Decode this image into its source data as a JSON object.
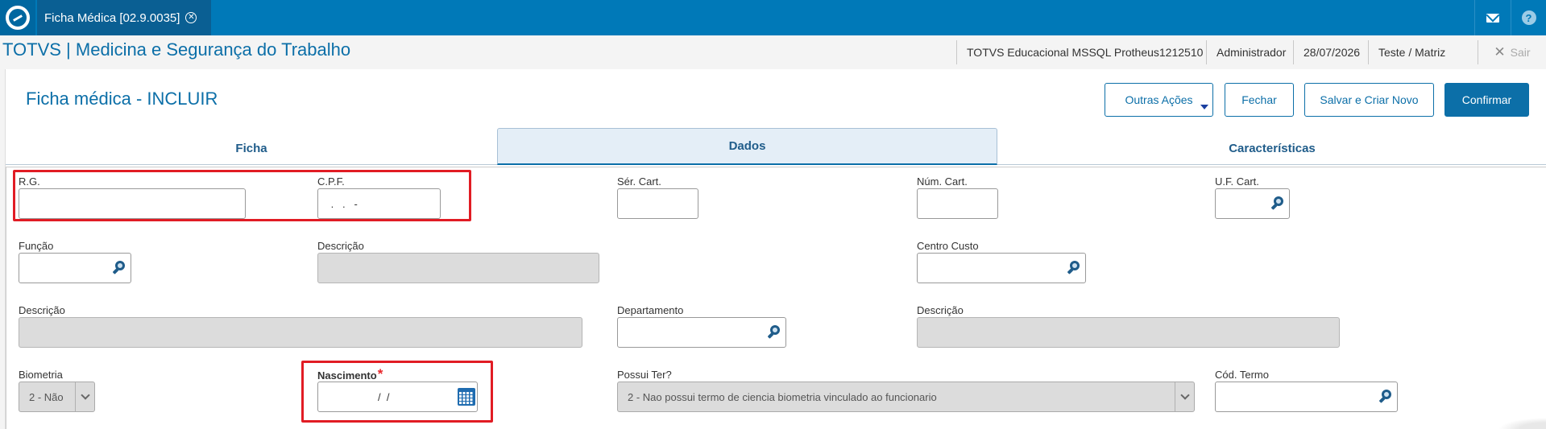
{
  "app": {
    "tab_title": "Ficha Médica [02.9.0035]",
    "tab_close": "✕",
    "brand": "TOTVS | Medicina e Segurança do Trabalho"
  },
  "header": {
    "environment": "TOTVS Educacional MSSQL Protheus1212510",
    "user": "Administrador",
    "date": "28/07/2026",
    "branch": "Teste / Matriz",
    "exit_label": "Sair"
  },
  "page": {
    "title": "Ficha médica - INCLUIR"
  },
  "actions": {
    "other_label": "Outras Ações",
    "close_label": "Fechar",
    "save_new_label": "Salvar e Criar Novo",
    "confirm_label": "Confirmar"
  },
  "tabs": [
    {
      "label": "Ficha"
    },
    {
      "label": "Dados"
    },
    {
      "label": "Características"
    }
  ],
  "form": {
    "rg_label": "R.G.",
    "rg_value": "",
    "cpf_label": "C.P.F.",
    "cpf_value": " .   .   -",
    "ser_cart_label": "Sér. Cart.",
    "num_cart_label": "Núm. Cart.",
    "uf_cart_label": "U.F. Cart.",
    "funcao_label": "Função",
    "descricao_funcao_label": "Descrição",
    "centro_custo_label": "Centro Custo",
    "descricao_cc_label": "Descrição",
    "departamento_label": "Departamento",
    "descricao_depto_label": "Descrição",
    "biometria_label": "Biometria",
    "biometria_value": "2 - Não",
    "nascimento_label": "Nascimento",
    "nascimento_required": "*",
    "nascimento_value": "/  /",
    "possui_ter_label": "Possui Ter?",
    "possui_ter_value": "2 - Nao possui termo de ciencia biometria vinculado ao funcionario",
    "cod_termo_label": "Cód. Termo"
  },
  "icons": {
    "logo": "totvs-logo-icon",
    "mail": "mail-icon",
    "help": "help-icon",
    "lookup": "magnifier-icon",
    "calendar": "calendar-icon"
  },
  "colors": {
    "brand_blue": "#0079b8",
    "accent": "#0c6fa8",
    "highlight_red": "#e11c24",
    "required": "#e8262a"
  }
}
